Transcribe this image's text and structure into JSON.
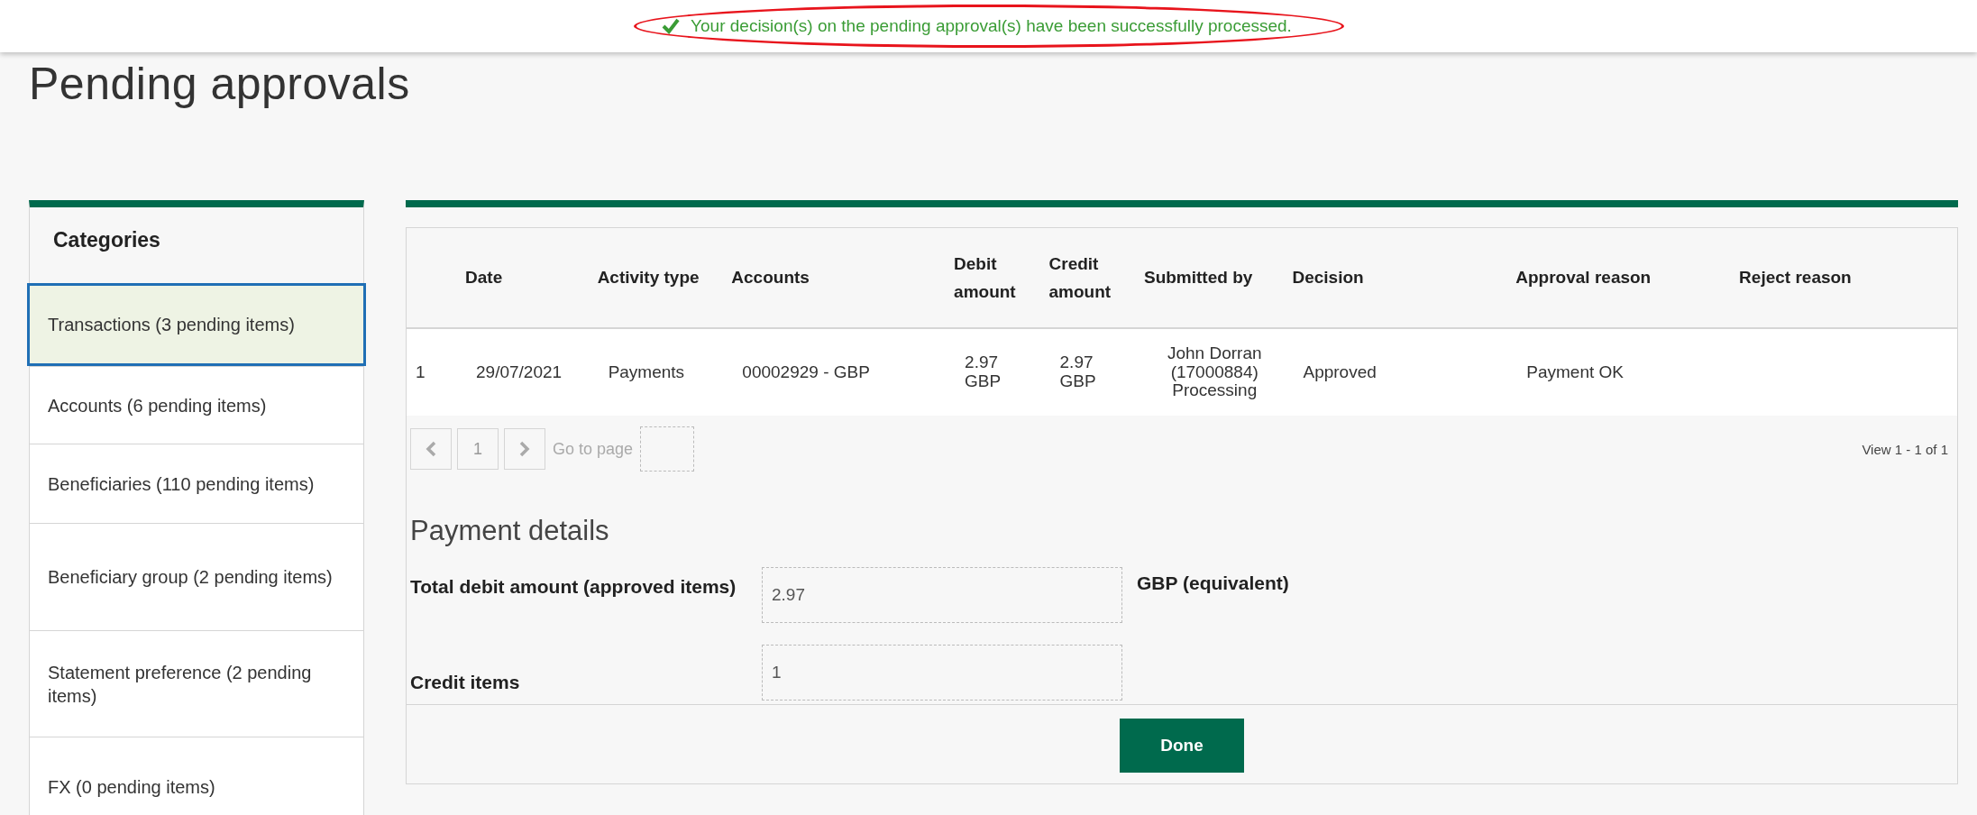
{
  "notification": {
    "message": "Your decision(s) on the pending approval(s) have been successfully processed."
  },
  "page_title": "Pending approvals",
  "sidebar": {
    "title": "Categories",
    "items": [
      {
        "label": "Transactions (3 pending items)",
        "selected": true
      },
      {
        "label": "Accounts (6 pending items)",
        "selected": false
      },
      {
        "label": "Beneficiaries (110 pending items)",
        "selected": false
      },
      {
        "label": "Beneficiary group (2 pending items)",
        "selected": false
      },
      {
        "label": "Statement preference (2 pending items)",
        "selected": false
      },
      {
        "label": "FX (0 pending items)",
        "selected": false
      }
    ]
  },
  "table": {
    "columns": [
      "Date",
      "Activity type",
      "Accounts",
      "Debit amount",
      "Credit amount",
      "Submitted by",
      "Decision",
      "Approval reason",
      "Reject reason"
    ],
    "rows": [
      {
        "number": "1",
        "cells": [
          "29/07/2021",
          "Payments",
          "00002929 - GBP",
          "2.97 GBP",
          "2.97 GBP",
          "John Dorran (17000884) Processing",
          "Approved",
          "Payment OK"
        ]
      }
    ]
  },
  "pagination": {
    "current_page": "1",
    "goto_label": "Go to page",
    "summary": "View 1 - 1 of 1"
  },
  "payment_details": {
    "title": "Payment details",
    "fields": [
      {
        "label": "Total debit amount (approved items)",
        "value": "2.97",
        "unit": "GBP (equivalent)"
      },
      {
        "label": "Credit items",
        "value": "1"
      }
    ]
  },
  "buttons": [
    "Done"
  ]
}
